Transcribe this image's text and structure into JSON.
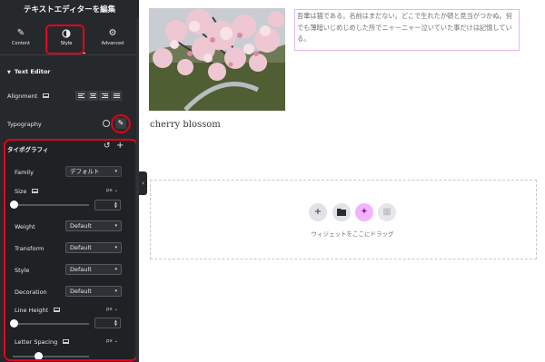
{
  "panel": {
    "title": "テキストエディターを編集",
    "tabs": [
      {
        "label": "Content",
        "icon": "pencil-icon"
      },
      {
        "label": "Style",
        "icon": "contrast-icon"
      },
      {
        "label": "Advanced",
        "icon": "gear-icon"
      }
    ],
    "active_tab": "Style",
    "section_title": "Text Editor",
    "alignment_label": "Alignment",
    "typography_label": "Typography"
  },
  "typography_popup": {
    "title": "タイポグラフィ",
    "family": {
      "label": "Family",
      "value": "デフォルト"
    },
    "size": {
      "label": "Size",
      "unit": "px"
    },
    "weight": {
      "label": "Weight",
      "value": "Default"
    },
    "transform": {
      "label": "Transform",
      "value": "Default"
    },
    "style": {
      "label": "Style",
      "value": "Default"
    },
    "decoration": {
      "label": "Decoration",
      "value": "Default"
    },
    "line_height": {
      "label": "Line Height",
      "unit": "px"
    },
    "letter_spacing": {
      "label": "Letter Spacing",
      "unit": "px"
    }
  },
  "canvas": {
    "image_caption": "cherry blossom",
    "body_text": "吾輩は猫である。名前はまだない。どこで生れたか頓と見当がつかぬ。何でも薄暗いじめじめした所でニャーニャー泣いていた事だけは記憶している。",
    "dropzone_text": "ウィジェットをここにドラッグ"
  },
  "colors": {
    "panel_bg": "#26292c",
    "highlight": "#e3001b",
    "ai_button": "#f2b4ff"
  }
}
